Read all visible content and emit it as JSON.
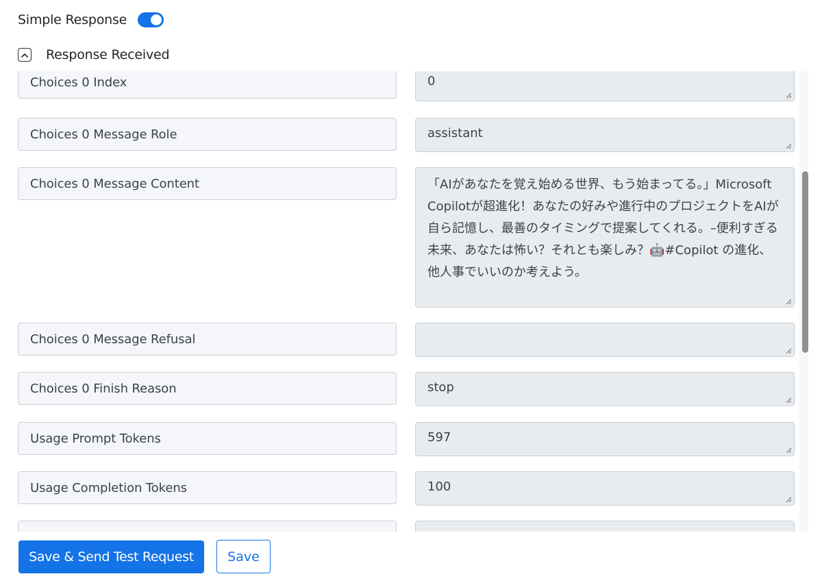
{
  "header": {
    "simple_response_label": "Simple Response",
    "simple_response_enabled": true,
    "section_title": "Response Received",
    "collapse_icon": "chevron-up-icon"
  },
  "fields": [
    {
      "name": "Choices 0 Index",
      "value": "0"
    },
    {
      "name": "Choices 0 Message Role",
      "value": "assistant"
    },
    {
      "name": "Choices 0 Message Content",
      "value": "「AIがあなたを覚え始める世界、もう始まってる。」Microsoft Copilotが超進化！あなたの好みや進行中のプロジェクトをAIが自ら記憶し、最善のタイミングで提案してくれる。–便利すぎる未来、あなたは怖い？それとも楽しみ？🤖#Copilot の進化、他人事でいいのか考えよう。"
    },
    {
      "name": "Choices 0 Message Refusal",
      "value": ""
    },
    {
      "name": "Choices 0 Finish Reason",
      "value": "stop"
    },
    {
      "name": "Usage Prompt Tokens",
      "value": "597"
    },
    {
      "name": "Usage Completion Tokens",
      "value": "100"
    },
    {
      "name": "",
      "value": ""
    }
  ],
  "footer": {
    "primary_button": "Save & Send Test Request",
    "secondary_button": "Save"
  },
  "colors": {
    "accent": "#1473e6",
    "field_name_bg": "#f4f6f9",
    "field_value_bg": "#e9ecef",
    "border": "#c9cfd6"
  }
}
